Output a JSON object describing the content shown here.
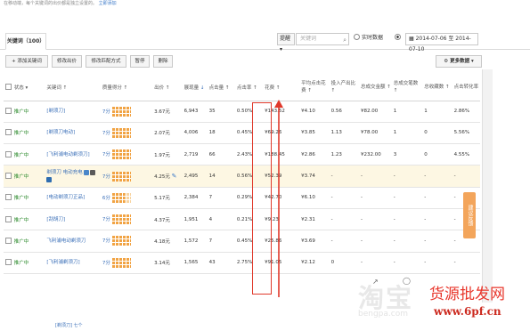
{
  "header": {
    "note": "在移动端，每个关键词的出价都是独立设置的。",
    "note_link": "立即添加"
  },
  "tabs": {
    "active": "关键词（100）"
  },
  "filters": {
    "select_label": "提醒",
    "search_placeholder": "关键词",
    "realtime_label": "实时数据",
    "date_range": "2014-07-06 至 2014-07-10"
  },
  "toolbar": {
    "add": "添加关键词",
    "edit_bid": "修改出价",
    "edit_match": "修改匹配方式",
    "pause": "暂停",
    "delete": "删除",
    "more": "更多数据"
  },
  "columns": [
    "状态",
    "关键词",
    "质量得分",
    "出价",
    "展现量",
    "点击量",
    "点击率",
    "花费",
    "平均点击花费",
    "投入产出比",
    "总成交金额",
    "总成交笔数",
    "总收藏数",
    "点击转化率"
  ],
  "rows": [
    {
      "status": "推广中",
      "keyword": "[剃须刀]",
      "score": "7分",
      "bid": "3.67元",
      "impressions": "6,943",
      "clicks": "35",
      "ctr": "0.50%",
      "cost": "¥143.52",
      "cpc": "¥4.10",
      "roi": "0.56",
      "revenue": "¥82.00",
      "orders": "1",
      "favs": "1",
      "cvr": "2.86%"
    },
    {
      "status": "推广中",
      "keyword": "[剃须刀电动]",
      "score": "7分",
      "bid": "2.07元",
      "impressions": "4,006",
      "clicks": "18",
      "ctr": "0.45%",
      "cost": "¥69.26",
      "cpc": "¥3.85",
      "roi": "1.13",
      "revenue": "¥78.00",
      "orders": "1",
      "favs": "0",
      "cvr": "5.56%"
    },
    {
      "status": "推广中",
      "keyword": "[飞利浦电动剃须刀]",
      "score": "7分",
      "bid": "1.97元",
      "impressions": "2,719",
      "clicks": "66",
      "ctr": "2.43%",
      "cost": "¥188.45",
      "cpc": "¥2.86",
      "roi": "1.23",
      "revenue": "¥232.00",
      "orders": "3",
      "favs": "0",
      "cvr": "4.55%"
    },
    {
      "status": "推广中",
      "keyword": "剃须刀 电动充电",
      "score": "7分",
      "bid": "4.25元",
      "impressions": "2,495",
      "clicks": "14",
      "ctr": "0.56%",
      "cost": "¥52.39",
      "cpc": "¥3.74",
      "roi": "-",
      "revenue": "-",
      "orders": "-",
      "favs": "-",
      "cvr": "-"
    },
    {
      "status": "推广中",
      "keyword": "[电动剃须刀正品]",
      "score": "6分",
      "bid": "5.17元",
      "impressions": "2,384",
      "clicks": "7",
      "ctr": "0.29%",
      "cost": "¥42.70",
      "cpc": "¥6.10",
      "roi": "-",
      "revenue": "-",
      "orders": "-",
      "favs": "-",
      "cvr": "-"
    },
    {
      "status": "推广中",
      "keyword": "[刮胡刀]",
      "score": "7分",
      "bid": "4.37元",
      "impressions": "1,951",
      "clicks": "4",
      "ctr": "0.21%",
      "cost": "¥9.23",
      "cpc": "¥2.31",
      "roi": "-",
      "revenue": "-",
      "orders": "-",
      "favs": "-",
      "cvr": "-"
    },
    {
      "status": "推广中",
      "keyword": "飞利浦电动剃须刀",
      "score": "7分",
      "bid": "4.18元",
      "impressions": "1,572",
      "clicks": "7",
      "ctr": "0.45%",
      "cost": "¥25.86",
      "cpc": "¥3.69",
      "roi": "-",
      "revenue": "-",
      "orders": "-",
      "favs": "-",
      "cvr": "-"
    },
    {
      "status": "推广中",
      "keyword": "[飞利浦剃须刀]",
      "score": "7分",
      "bid": "3.14元",
      "impressions": "1,565",
      "clicks": "43",
      "ctr": "2.75%",
      "cost": "¥91.05",
      "cpc": "¥2.12",
      "roi": "0",
      "revenue": "-",
      "orders": "-",
      "favs": "-",
      "cvr": "-"
    }
  ],
  "side_tab": "建议反馈",
  "watermark": "淘宝",
  "watermark_url": "bengpa.com",
  "site_name": "货源批发网",
  "site_url": "www.6pf.cn",
  "partial_row": "[剃须刀] 七个",
  "colors": {
    "accent": "#3a6fb8",
    "status": "#2c8a2c",
    "highlight": "#e0392b",
    "grid": "#f1a343"
  }
}
